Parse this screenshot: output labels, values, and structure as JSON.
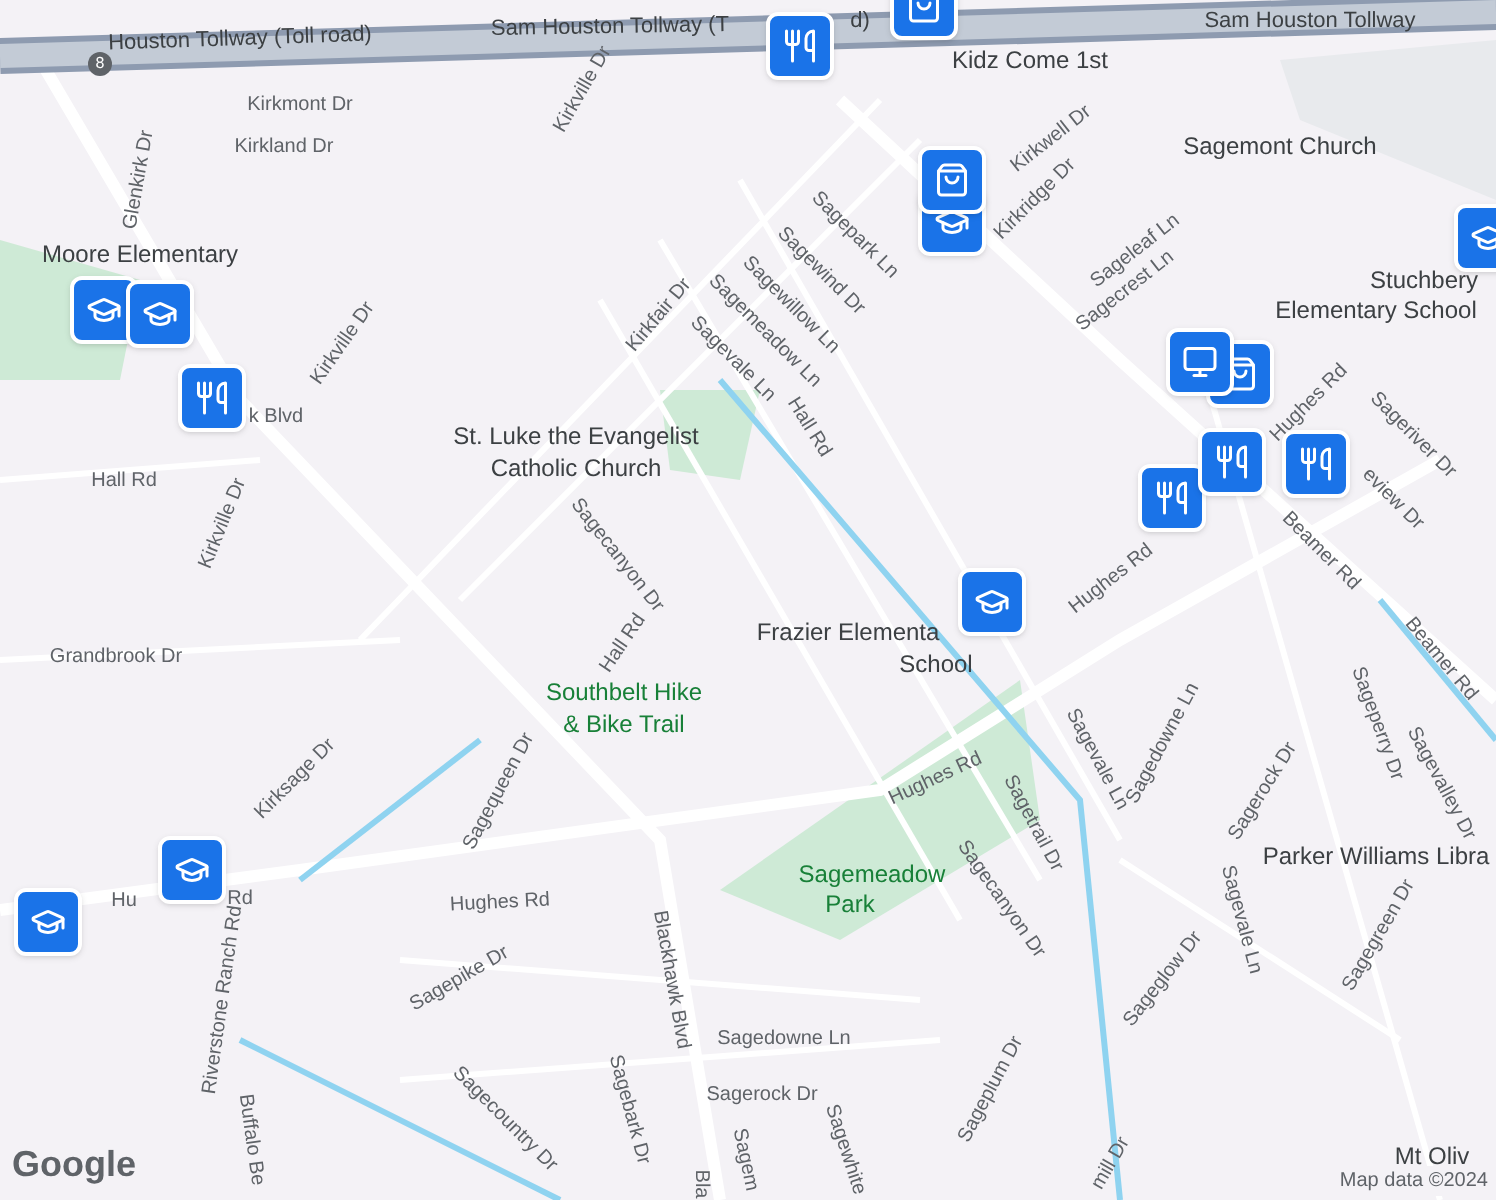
{
  "labels": [
    {
      "text": "Houston Tollway (Toll road)",
      "kind": "highway"
    },
    {
      "text": "Sam Houston Tollway (T",
      "kind": "highway"
    },
    {
      "text": "d)",
      "kind": "highway"
    },
    {
      "text": "Sam Houston Tollway",
      "kind": "highway"
    },
    {
      "text": "8",
      "kind": "shield"
    },
    {
      "text": "Kidz Come 1st",
      "kind": "place"
    },
    {
      "text": "Kirkmont Dr",
      "kind": "street"
    },
    {
      "text": "Kirkland Dr",
      "kind": "street"
    },
    {
      "text": "Glenkirk Dr",
      "kind": "street"
    },
    {
      "text": "Kirkville Dr",
      "kind": "street"
    },
    {
      "text": "Kirkwell Dr",
      "kind": "street"
    },
    {
      "text": "Kirkridge Dr",
      "kind": "street"
    },
    {
      "text": "Sagemont Church",
      "kind": "place"
    },
    {
      "text": "Moore Elementary",
      "kind": "place"
    },
    {
      "text": "Sagepark Ln",
      "kind": "street"
    },
    {
      "text": "Sagewind Dr",
      "kind": "street"
    },
    {
      "text": "Sagewillow Ln",
      "kind": "street"
    },
    {
      "text": "Sagemeadow Ln",
      "kind": "street"
    },
    {
      "text": "Sagevale Ln",
      "kind": "street"
    },
    {
      "text": "Kirkfair Dr",
      "kind": "street"
    },
    {
      "text": "Sageleaf Ln",
      "kind": "street"
    },
    {
      "text": "Sagecrest Ln",
      "kind": "street"
    },
    {
      "text": "Stuchbery",
      "kind": "place"
    },
    {
      "text": "Elementary School",
      "kind": "place"
    },
    {
      "text": "Kirkville Dr",
      "kind": "street"
    },
    {
      "text": "k Blvd",
      "kind": "street"
    },
    {
      "text": "Hall Rd",
      "kind": "street"
    },
    {
      "text": "St. Luke the Evangelist",
      "kind": "place"
    },
    {
      "text": "Catholic Church",
      "kind": "place"
    },
    {
      "text": "Hall Rd",
      "kind": "street"
    },
    {
      "text": "Hughes Rd",
      "kind": "street"
    },
    {
      "text": "Sageriver Dr",
      "kind": "street"
    },
    {
      "text": "eview Dr",
      "kind": "street"
    },
    {
      "text": "Kirkville Dr",
      "kind": "street"
    },
    {
      "text": "Sagecanyon Dr",
      "kind": "street"
    },
    {
      "text": "Hughes Rd",
      "kind": "street"
    },
    {
      "text": "Beamer Rd",
      "kind": "street"
    },
    {
      "text": "Grandbrook Dr",
      "kind": "street"
    },
    {
      "text": "Frazier Elementa",
      "kind": "place"
    },
    {
      "text": "School",
      "kind": "place"
    },
    {
      "text": "Beamer Rd",
      "kind": "street"
    },
    {
      "text": "Hall Rd",
      "kind": "street"
    },
    {
      "text": "Southbelt Hike",
      "kind": "park"
    },
    {
      "text": "& Bike Trail",
      "kind": "park"
    },
    {
      "text": "Sagevale Ln",
      "kind": "street"
    },
    {
      "text": "Sagedowne Ln",
      "kind": "street"
    },
    {
      "text": "Sageperry Dr",
      "kind": "street"
    },
    {
      "text": "Sagevalley Dr",
      "kind": "street"
    },
    {
      "text": "Kirksage Dr",
      "kind": "street"
    },
    {
      "text": "Sagequeen Dr",
      "kind": "street"
    },
    {
      "text": "Hughes Rd",
      "kind": "street"
    },
    {
      "text": "Sagerock Dr",
      "kind": "street"
    },
    {
      "text": "Sagetrail Dr",
      "kind": "street"
    },
    {
      "text": "Sagecanyon Dr",
      "kind": "street"
    },
    {
      "text": "Parker Williams Libra",
      "kind": "place"
    },
    {
      "text": "Hu",
      "kind": "street"
    },
    {
      "text": "Rd",
      "kind": "street"
    },
    {
      "text": "Hughes Rd",
      "kind": "street"
    },
    {
      "text": "Sagemeadow",
      "kind": "park"
    },
    {
      "text": "Park",
      "kind": "park"
    },
    {
      "text": "Blackhawk Blvd",
      "kind": "street"
    },
    {
      "text": "Sagevale Ln",
      "kind": "street"
    },
    {
      "text": "Sagegreen Dr",
      "kind": "street"
    },
    {
      "text": "Riverstone Ranch Rd",
      "kind": "street"
    },
    {
      "text": "Sagepike Dr",
      "kind": "street"
    },
    {
      "text": "Sageglow Dr",
      "kind": "street"
    },
    {
      "text": "Sagedowne Ln",
      "kind": "street"
    },
    {
      "text": "Sageplum Dr",
      "kind": "street"
    },
    {
      "text": "Sagecountry Dr",
      "kind": "street"
    },
    {
      "text": "Sagebark Dr",
      "kind": "street"
    },
    {
      "text": "Sagerock Dr",
      "kind": "street"
    },
    {
      "text": "Buffalo Be",
      "kind": "street"
    },
    {
      "text": "Sagem",
      "kind": "street"
    },
    {
      "text": "Sagewhite",
      "kind": "street"
    },
    {
      "text": "mill Dr",
      "kind": "street"
    },
    {
      "text": "Mt Oliv",
      "kind": "place"
    },
    {
      "text": "Bla",
      "kind": "street"
    }
  ],
  "footer": {
    "logo": "Google",
    "attribution": "Map data ©2024"
  }
}
